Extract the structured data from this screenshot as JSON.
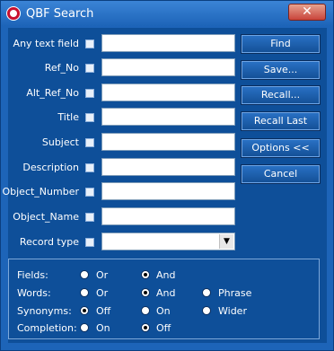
{
  "window": {
    "title": "QBF Search",
    "close_glyph": "✕"
  },
  "fields": [
    {
      "label": "Any text field"
    },
    {
      "label": "Ref_No"
    },
    {
      "label": "Alt_Ref_No"
    },
    {
      "label": "Title"
    },
    {
      "label": "Subject"
    },
    {
      "label": "Description"
    },
    {
      "label": "Object_Number"
    },
    {
      "label": "Object_Name"
    },
    {
      "label": "Record type",
      "type": "select",
      "value": ""
    }
  ],
  "buttons": [
    {
      "label": "Find"
    },
    {
      "label": "Save..."
    },
    {
      "label": "Recall..."
    },
    {
      "label": "Recall Last"
    },
    {
      "label": "Options <<"
    },
    {
      "label": "Cancel"
    }
  ],
  "options": {
    "fields": {
      "label": "Fields:",
      "choices": [
        "Or",
        "And"
      ],
      "selected": "And"
    },
    "words": {
      "label": "Words:",
      "choices": [
        "Or",
        "And",
        "Phrase"
      ],
      "selected": "And"
    },
    "synonyms": {
      "label": "Synonyms:",
      "choices": [
        "Off",
        "On",
        "Wider"
      ],
      "selected": "Off"
    },
    "completion": {
      "label": "Completion:",
      "choices": [
        "On",
        "Off"
      ],
      "selected": "Off"
    }
  },
  "colors": {
    "client_bg": "#0e4f99",
    "title_bg": "#1d64b8",
    "text": "#ffffff"
  }
}
